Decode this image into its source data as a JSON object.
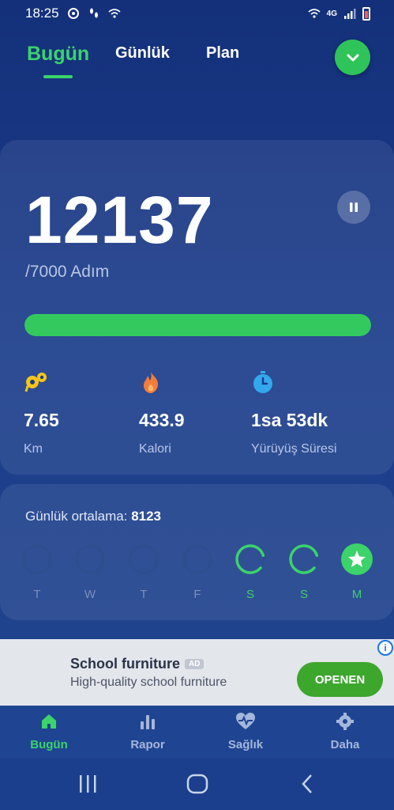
{
  "status": {
    "time": "18:25",
    "network": "4G"
  },
  "tabs": [
    {
      "label": "Bugün"
    },
    {
      "label": "Günlük"
    },
    {
      "label": "Plan"
    }
  ],
  "today": {
    "steps": "12137",
    "goal_text": "/7000 Adım",
    "progress_fraction": 1.0,
    "stats": [
      {
        "value": "7.65",
        "label": "Km",
        "icon": "footprint-location-icon",
        "color": "#f5c518"
      },
      {
        "value": "433.9",
        "label": "Kalori",
        "icon": "flame-icon",
        "color": "#f57c3a"
      },
      {
        "value": "1sa 53dk",
        "label": "Yürüyüş Süresi",
        "icon": "stopwatch-icon",
        "color": "#33a8ee"
      }
    ]
  },
  "weekly": {
    "avg_label": "Günlük ortalama:",
    "avg_value": "8123",
    "days": [
      {
        "label": "T",
        "state": "empty"
      },
      {
        "label": "W",
        "state": "empty"
      },
      {
        "label": "T",
        "state": "empty"
      },
      {
        "label": "F",
        "state": "empty"
      },
      {
        "label": "S",
        "state": "partial"
      },
      {
        "label": "S",
        "state": "partial"
      },
      {
        "label": "M",
        "state": "done"
      }
    ]
  },
  "ad": {
    "title": "School furniture",
    "badge": "AD",
    "subtitle": "High-quality school furniture",
    "button": "OPENEN"
  },
  "nav": [
    {
      "label": "Bugün",
      "icon": "home-icon"
    },
    {
      "label": "Rapor",
      "icon": "bar-chart-icon"
    },
    {
      "label": "Sağlık",
      "icon": "heartbeat-icon"
    },
    {
      "label": "Daha",
      "icon": "gear-icon"
    }
  ],
  "colors": {
    "accent": "#3bd36a",
    "background": "#1b3c8a"
  }
}
